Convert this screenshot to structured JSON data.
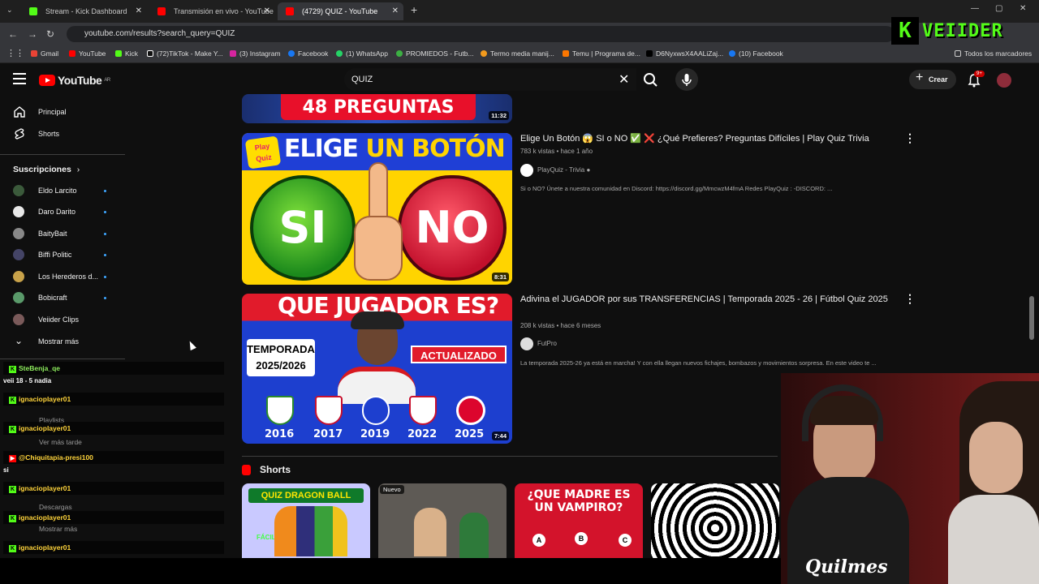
{
  "browser": {
    "tabs": [
      {
        "title": "Stream - Kick Dashboard",
        "color": "#53fc18"
      },
      {
        "title": "Transmisión en vivo - YouTube",
        "color": "#ff0000"
      },
      {
        "title": "(4729) QUIZ - YouTube",
        "color": "#ff0000"
      }
    ],
    "url": "youtube.com/results?search_query=QUIZ",
    "bookmarks": [
      "Gmail",
      "YouTube",
      "Kick",
      "(72)TikTok - Make Y...",
      "(3) Instagram",
      "Facebook",
      "(1) WhatsApp",
      "PROMIEDOS - Futb...",
      "Termo media manij...",
      "Temu | Programa de...",
      "D6NyxwsX4AALiZaj...",
      "(10) Facebook"
    ],
    "all_bookmarks": "Todos los marcadores"
  },
  "overlay": {
    "kick_letter": "K",
    "streamer": "VEIIDER"
  },
  "yt": {
    "logo": "YouTube",
    "region": "AR",
    "search_value": "QUIZ",
    "create": "Crear",
    "notif_badge": "9+"
  },
  "sidebar": {
    "principal": "Principal",
    "shorts": "Shorts",
    "subs_title": "Suscripciones",
    "subs": [
      {
        "name": "Eldo Larcito",
        "color": "#3b5a3b"
      },
      {
        "name": "Daro Darito",
        "color": "#e8e8e8"
      },
      {
        "name": "BaityBait",
        "color": "#888888"
      },
      {
        "name": "Biffi Politic",
        "color": "#444466"
      },
      {
        "name": "Los Herederos d...",
        "color": "#c8a24a"
      },
      {
        "name": "Bobicraft",
        "color": "#5a9a6a"
      },
      {
        "name": "Veiider Clips",
        "color": "#7a5a5a"
      }
    ],
    "more": "Mostrar más"
  },
  "chat": [
    {
      "user": "SteBenja_qe",
      "message": "veii 18 - 5 nadia",
      "green": true
    },
    {
      "user": "ignacioplayer01",
      "message": "",
      "green": false
    },
    {
      "user": "ignacioplayer01",
      "message": "",
      "green": false
    },
    {
      "user": "@Chiquitapia-presi100",
      "message": "si",
      "green": false
    },
    {
      "user": "ignacioplayer01",
      "message": "",
      "green": false
    },
    {
      "user": "ignacioplayer01",
      "message": "",
      "green": false
    },
    {
      "user": "ignacioplayer01",
      "message": "",
      "green": false
    }
  ],
  "ghost_sidebar": {
    "playlists": "Playlists",
    "later": "Ver más tarde",
    "downloads": "Descargas",
    "more": "Mostrar más"
  },
  "videos": [
    {
      "thumb_text": "48 PREGUNTAS",
      "duration": "11:32"
    },
    {
      "title": "Elige Un Botón 😱 SI o NO ✅ ❌ ¿Qué Prefieres? Preguntas Difíciles | Play Quiz Trivia",
      "meta": "783 k vistas • hace 1 año",
      "channel": "PlayQuiz - Trivia",
      "desc": "Si o NO? Únete a nuestra comunidad en Discord: https://discord.gg/MmcwzM4fmA Redes PlayQuiz : -DISCORD: ...",
      "duration": "8:31",
      "thumb_title_1": "ELIGE",
      "thumb_title_2": "UN BOTÓN",
      "thumb_yes": "SI",
      "thumb_no": "NO",
      "thumb_logo_1": "Play",
      "thumb_logo_2": "Quiz"
    },
    {
      "title": "Adivina el JUGADOR por sus TRANSFERENCIAS | Temporada 2025 - 26 | Fútbol Quiz 2025",
      "meta": "208 k vistas • hace 6 meses",
      "channel": "FutPro",
      "desc": "La temporada 2025-26 ya está en marcha! Y con ella llegan nuevos fichajes, bombazos y movimientos sorpresa. En este video te ...",
      "duration": "7:44",
      "thumb_title": "QUE JUGADOR ES?",
      "thumb_season_1": "TEMPORADA",
      "thumb_season_2": "2025/2026",
      "thumb_updated": "ACTUALIZADO",
      "thumb_years": [
        "2016",
        "2017",
        "2019",
        "2022",
        "2025"
      ]
    }
  ],
  "shorts": {
    "title": "Shorts",
    "items": [
      {
        "label": "QUIZ DRAGON BALL",
        "sub": "FÁCIL"
      },
      {
        "label": "Nuevo",
        "sub": ""
      },
      {
        "label": "¿QUE MADRE ES UN VAMPIRO?",
        "sub": "A B C"
      },
      {
        "label": "",
        "sub": ""
      }
    ]
  }
}
